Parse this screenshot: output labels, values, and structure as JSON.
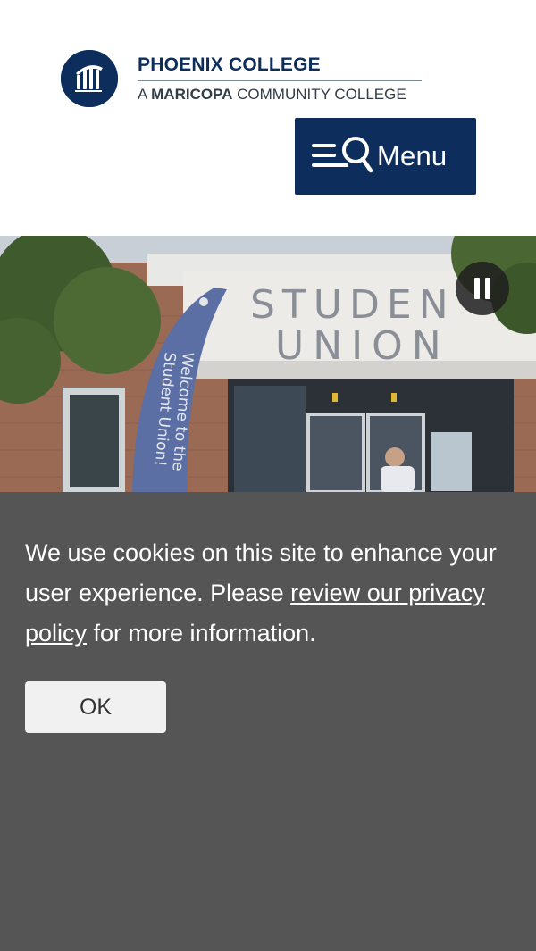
{
  "header": {
    "logo_title": "PHOENIX COLLEGE",
    "logo_sub_prefix": "A ",
    "logo_sub_bold": "MARICOPA",
    "logo_sub_suffix": " COMMUNITY COLLEGE",
    "menu_label": "Menu",
    "menu_icons": [
      "hamburger-icon",
      "search-icon"
    ]
  },
  "hero": {
    "building_sign_line1": "STUDEN",
    "building_sign_line2": "UNION",
    "banner_line1": "Welcome to the",
    "banner_line2": "Student Union!",
    "controls": {
      "pause_icon": "pause-icon"
    }
  },
  "cookie_banner": {
    "text_before": "We use cookies on this site to enhance your user experience. Please ",
    "link_text": "review our privacy policy",
    "text_after": " for more information.",
    "ok_label": "OK"
  },
  "colors": {
    "brand_navy": "#0d2e5c",
    "cookie_bg": "#555555",
    "ok_bg": "#f1f1f1"
  }
}
